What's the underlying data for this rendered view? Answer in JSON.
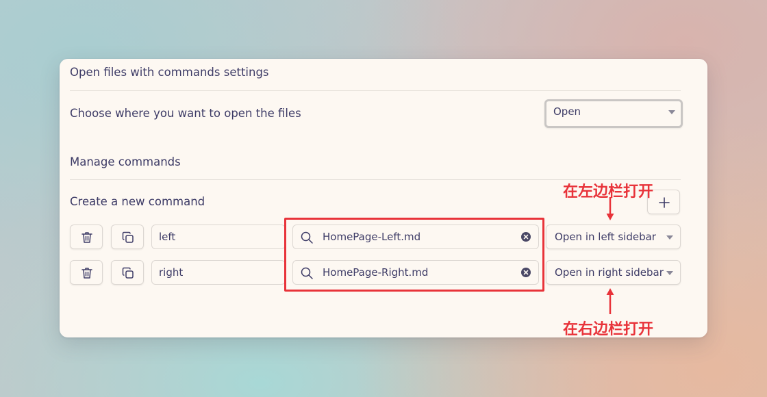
{
  "settings": {
    "title": "Open files with commands settings",
    "open_location": {
      "label": "Choose where you want to open the files",
      "value": "Open"
    },
    "manage_heading": "Manage commands",
    "create_label": "Create a new command",
    "add_icon": "plus-icon",
    "commands": [
      {
        "name": "left",
        "file": "HomePage-Left.md",
        "location": "Open in left sidebar"
      },
      {
        "name": "right",
        "file": "HomePage-Right.md",
        "location": "Open in right sidebar"
      }
    ]
  },
  "annotations": {
    "left": "在左边栏打开",
    "right": "在右边栏打开",
    "color": "#e8333a"
  },
  "colors": {
    "panel_bg": "#fdf8f2",
    "text": "#3d3b66",
    "border": "#dcd7d2"
  }
}
